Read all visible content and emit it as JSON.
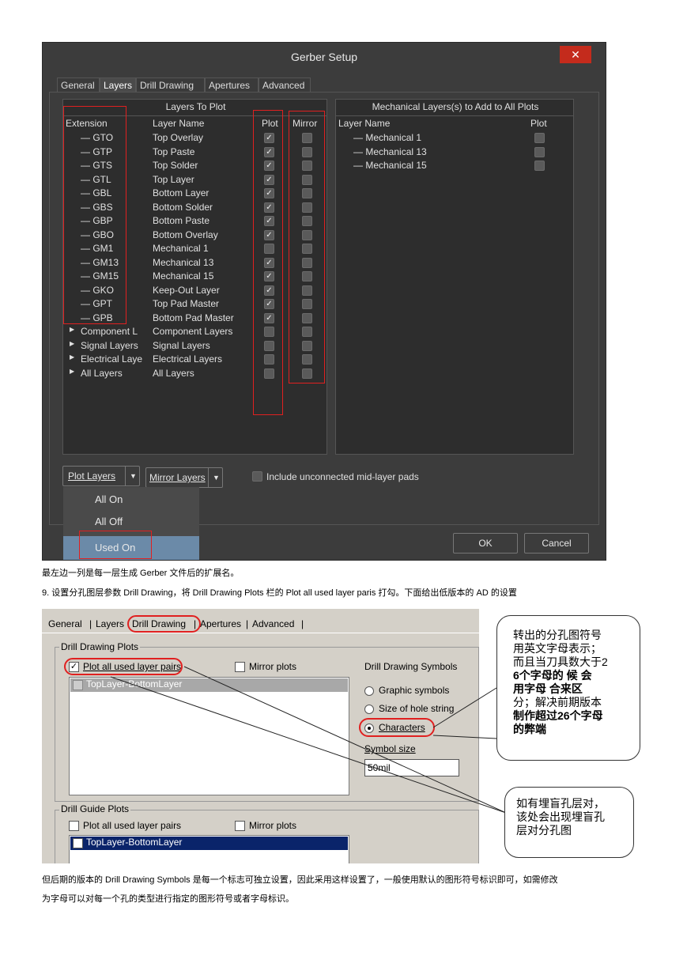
{
  "dialog": {
    "title": "Gerber Setup",
    "close_glyph": "✕",
    "tabs": [
      "General",
      "Layers",
      "Drill Drawing",
      "Apertures",
      "Advanced"
    ],
    "left_group_title": "Layers To Plot",
    "left_cols": {
      "extension": "Extension",
      "layer_name": "Layer Name",
      "plot": "Plot",
      "mirror": "Mirror"
    },
    "layers": [
      {
        "ext": "GTO",
        "name": "Top Overlay",
        "plot": true
      },
      {
        "ext": "GTP",
        "name": "Top Paste",
        "plot": true
      },
      {
        "ext": "GTS",
        "name": "Top Solder",
        "plot": true
      },
      {
        "ext": "GTL",
        "name": "Top Layer",
        "plot": true
      },
      {
        "ext": "GBL",
        "name": "Bottom Layer",
        "plot": true
      },
      {
        "ext": "GBS",
        "name": "Bottom Solder",
        "plot": true
      },
      {
        "ext": "GBP",
        "name": "Bottom Paste",
        "plot": true
      },
      {
        "ext": "GBO",
        "name": "Bottom Overlay",
        "plot": true
      },
      {
        "ext": "GM1",
        "name": "Mechanical 1",
        "plot": false
      },
      {
        "ext": "GM13",
        "name": "Mechanical 13",
        "plot": true
      },
      {
        "ext": "GM15",
        "name": "Mechanical 15",
        "plot": true
      },
      {
        "ext": "GKO",
        "name": "Keep-Out Layer",
        "plot": true
      },
      {
        "ext": "GPT",
        "name": "Top Pad Master",
        "plot": true
      },
      {
        "ext": "GPB",
        "name": "Bottom Pad Master",
        "plot": true
      }
    ],
    "groups": [
      {
        "ext": "Component L",
        "name": "Component Layers"
      },
      {
        "ext": "Signal Layers",
        "name": "Signal Layers"
      },
      {
        "ext": "Electrical Laye",
        "name": "Electrical Layers"
      },
      {
        "ext": "All Layers",
        "name": "All Layers"
      }
    ],
    "right_group_title": "Mechanical Layers(s) to Add to All Plots",
    "right_cols": {
      "layer_name": "Layer Name",
      "plot": "Plot"
    },
    "mech_layers": [
      "Mechanical 1",
      "Mechanical 13",
      "Mechanical 15"
    ],
    "plot_layers_btn": "Plot Layers",
    "mirror_layers_btn": "Mirror Layers",
    "include_pads_label": "Include unconnected mid-layer pads",
    "menu": [
      "All On",
      "All Off",
      "Used On"
    ],
    "ok": "OK",
    "cancel": "Cancel"
  },
  "text1": "最左边一列是每一层生成 Gerber 文件后的扩展名。",
  "text2": "9.    设置分孔图层参数 Drill Drawing，将 Drill Drawing Plots 栏的 Plot all used layer paris 打勾。下面给出低版本的 AD 的设置",
  "old_dialog": {
    "tabs": [
      "General",
      "Layers",
      "Drill Drawing",
      "Apertures",
      "Advanced"
    ],
    "drill_plots_title": "Drill Drawing Plots",
    "plot_all": "Plot all used layer pairs",
    "mirror": "Mirror plots",
    "list_item": "TopLayer-BottomLayer",
    "symbols_title": "Drill Drawing Symbols",
    "graphic": "Graphic symbols",
    "size_string": "Size of hole string",
    "characters": "Characters",
    "symbol_size_label": "Symbol size",
    "symbol_size_value": "50mil",
    "guide_title": "Drill Guide Plots",
    "guide_plot_all": "Plot all used layer pairs",
    "guide_mirror": "Mirror plots",
    "guide_item": "TopLayer-BottomLayer"
  },
  "callout1": [
    "转出的分孔图符号",
    "用英文字母表示；",
    "而且当刀具数大于2",
    "6个字母的 候 会",
    "用字母 合来区",
    "分；解决前期版本",
    "制作超过26个字母",
    "的弊端"
  ],
  "callout2": [
    "如有埋盲孔层对，",
    "该处会出现埋盲孔",
    "层对分孔图"
  ],
  "text3": "但后期的版本的 Drill Drawing Symbols 是每一个标志可独立设置，因此采用这样设置了，一般使用默认的图形符号标识即可，如需修改",
  "text4": "为字母可以对每一个孔的类型进行指定的图形符号或者字母标识。"
}
